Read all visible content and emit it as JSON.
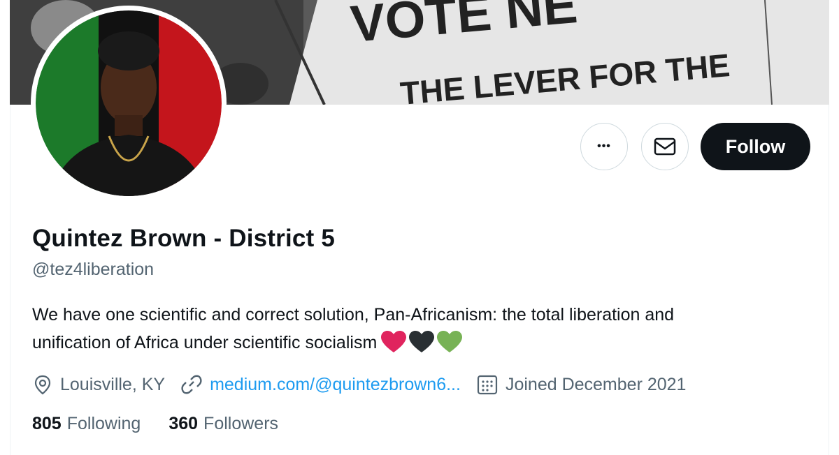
{
  "banner": {
    "sign_line1": "VOTE NE",
    "sign_line2": "THE LEVER FOR THE"
  },
  "actions": {
    "more_label": "•••",
    "follow_label": "Follow"
  },
  "profile": {
    "name": "Quintez Brown - District 5",
    "handle": "@tez4liberation",
    "bio_line1": "We have one scientific and correct solution, Pan-Africanism: the total liberation and",
    "bio_line2": "unification of Africa under scientific socialism",
    "heart_colors": [
      "#e0245e",
      "#292f33",
      "#77b255"
    ],
    "location": "Louisville, KY",
    "website": "medium.com/@quintezbrown6...",
    "joined": "Joined December 2021"
  },
  "stats": {
    "following_count": "805",
    "following_label": "Following",
    "followers_count": "360",
    "followers_label": "Followers"
  },
  "colors": {
    "primary_text": "#0f1419",
    "secondary_text": "#536471",
    "link": "#1d9bf0",
    "follow_bg": "#0f1419"
  }
}
